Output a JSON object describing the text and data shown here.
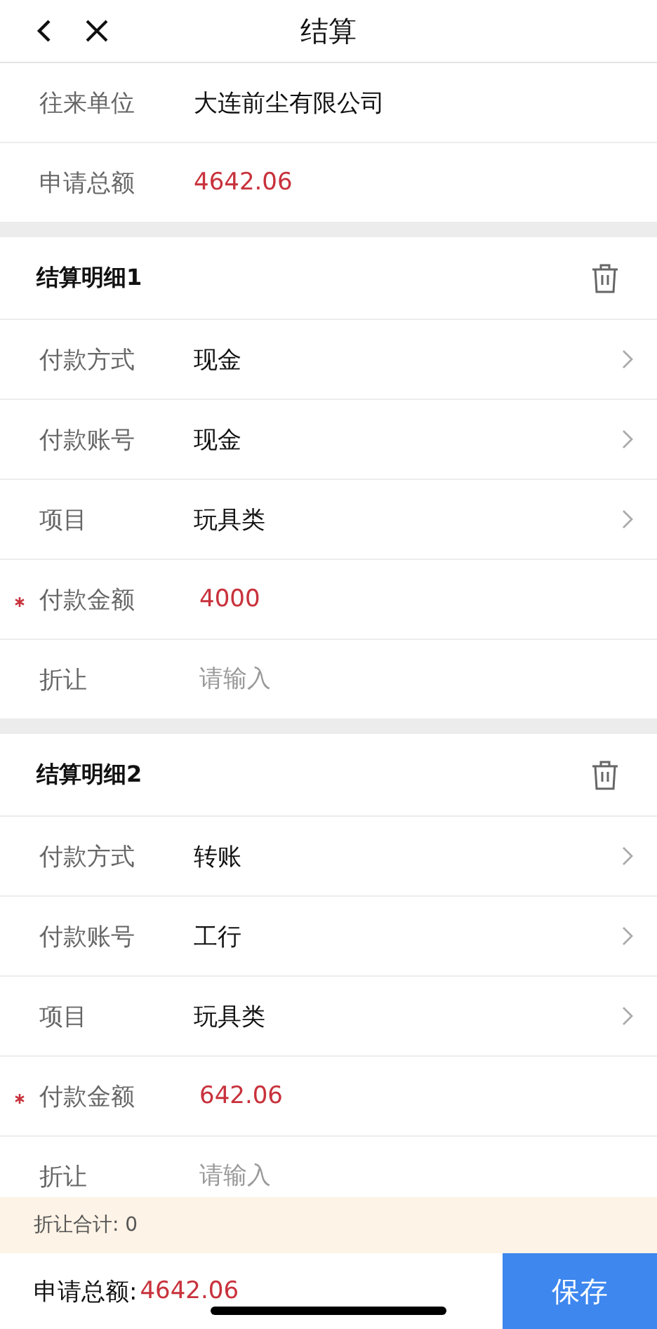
{
  "header": {
    "title": "结算"
  },
  "summary": [
    {
      "label": "往来单位",
      "value": "大连前尘有限公司",
      "kind": "text"
    },
    {
      "label": "申请总额",
      "value": "4642.06",
      "kind": "amount"
    }
  ],
  "sections": [
    {
      "title": "结算明细1",
      "fields": [
        {
          "label": "付款方式",
          "value": "现金",
          "kind": "select",
          "required": false
        },
        {
          "label": "付款账号",
          "value": "现金",
          "kind": "select",
          "required": false
        },
        {
          "label": "项目",
          "value": "玩具类",
          "kind": "select",
          "required": false
        },
        {
          "label": "付款金额",
          "value": "4000",
          "kind": "amount",
          "required": true
        },
        {
          "label": "折让",
          "placeholder": "请输入",
          "kind": "input",
          "required": false
        }
      ]
    },
    {
      "title": "结算明细2",
      "fields": [
        {
          "label": "付款方式",
          "value": "转账",
          "kind": "select",
          "required": false
        },
        {
          "label": "付款账号",
          "value": "工行",
          "kind": "select",
          "required": false
        },
        {
          "label": "项目",
          "value": "玩具类",
          "kind": "select",
          "required": false
        },
        {
          "label": "付款金额",
          "value": "642.06",
          "kind": "amount",
          "required": true
        },
        {
          "label": "折让",
          "placeholder": "请输入",
          "kind": "input",
          "required": false
        }
      ]
    }
  ],
  "discount_total": "折让合计: 0",
  "footer": {
    "total_label": "申请总额:",
    "total_value": "4642.06",
    "save_button": "保存"
  }
}
